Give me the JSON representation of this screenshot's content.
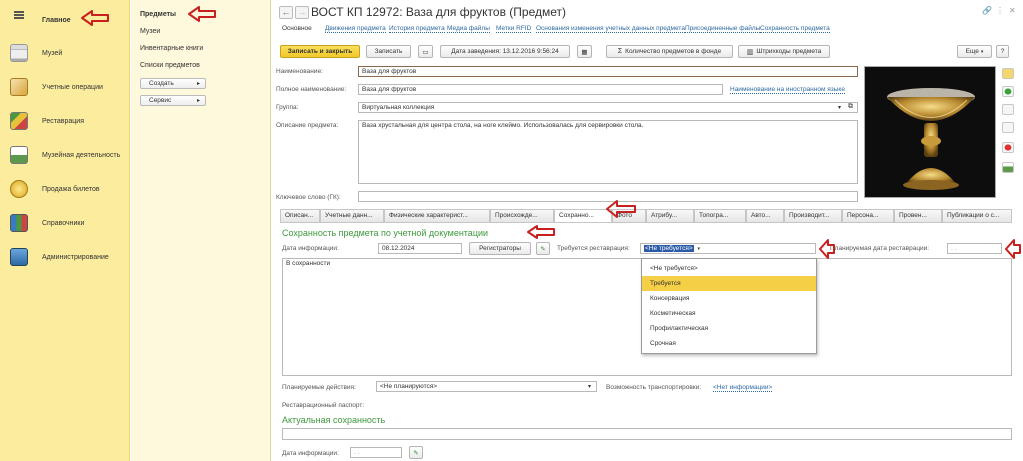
{
  "left_nav": {
    "items": [
      {
        "label": "Главное"
      },
      {
        "label": "Музей"
      },
      {
        "label": "Учетные операции"
      },
      {
        "label": "Реставрация"
      },
      {
        "label": "Музейная деятельность"
      },
      {
        "label": "Продажа билетов"
      },
      {
        "label": "Справочники"
      },
      {
        "label": "Администрирование"
      }
    ]
  },
  "sub_nav": {
    "title": "Предметы",
    "links": [
      "Музеи",
      "Инвентарные книги",
      "Списки предметов"
    ],
    "buttons": [
      "Создать",
      "Сервис"
    ]
  },
  "window": {
    "title": "ВОСТ КП 12972: Ваза для фруктов (Предмет)"
  },
  "nav_tabs": [
    "Основное",
    "Движения предмета",
    "История предмета",
    "Медиа файлы",
    "Метки RFID",
    "Основания изменения учетных данных предмета",
    "Присоединенные файлы",
    "Сохранность предмета"
  ],
  "toolbar": {
    "save_close": "Записать и закрыть",
    "save": "Записать",
    "created_date": "Дата заведения: 13.12.2016 9:56:24",
    "qty_in_fund": "Количество предметов в фонде",
    "barcodes": "Штрихкоды предмета",
    "more": "Еще",
    "help": "?"
  },
  "form": {
    "name_label": "Наименование:",
    "name_value": "Ваза для фруктов",
    "full_name_label": "Полное наименование:",
    "full_name_value": "Ваза для фруктов",
    "foreign_name_link": "Наименование на иностранном языке",
    "group_label": "Группа:",
    "group_value": "Виртуальная коллекция",
    "desc_label": "Описание предмета:",
    "desc_value": "Ваза хрустальная для центра стола, на ноге клеймо. Использовалась для сервировки стола.",
    "keyword_label": "Ключевое слово (ГК):"
  },
  "panel_tabs": [
    "Описан...",
    "Учетные данн...",
    "Физические характерист...",
    "Происхожде...",
    "Сохранно...",
    "Фото",
    "Атрибу...",
    "Топогра...",
    "Авто...",
    "Производит...",
    "Персона...",
    "Провен...",
    "Публикации о с..."
  ],
  "condition": {
    "section_title": "Сохранность предмета по учетной документации",
    "date_label": "Дата информации:",
    "date_value": "08.12.2024",
    "registrators_button": "Регистраторы",
    "restoration_label": "Требуется реставрация:",
    "restoration_value": "<Не требуется>",
    "planned_date_label": "Планируемая дата реставрации:",
    "planned_date_value": ". .",
    "state_text": "В сохранности",
    "planned_actions_label": "Планируемые действия:",
    "planned_actions_value": "<Не планируются>",
    "transport_label": "Возможность транспортировки:",
    "transport_value": "<Нет информации>",
    "passport_label": "Реставрационный паспорт:",
    "actual_title": "Актуальная сохранность",
    "actual_date_label": "Дата информации:",
    "actual_date_value": ". ."
  },
  "dropdown": {
    "options": [
      "<Не требуется>",
      "Требуется",
      "Консервация",
      "Косметическая",
      "Профилактическая",
      "Срочная"
    ],
    "highlighted_index": 1
  },
  "colors": {
    "nav_bg": "#fbec9e",
    "subnav_bg": "#fef8dc",
    "primary_btn": "#f5cf46",
    "section_green": "#3e9a3e",
    "link_blue": "#2d6aa3",
    "arrow_red": "#c8201e"
  }
}
